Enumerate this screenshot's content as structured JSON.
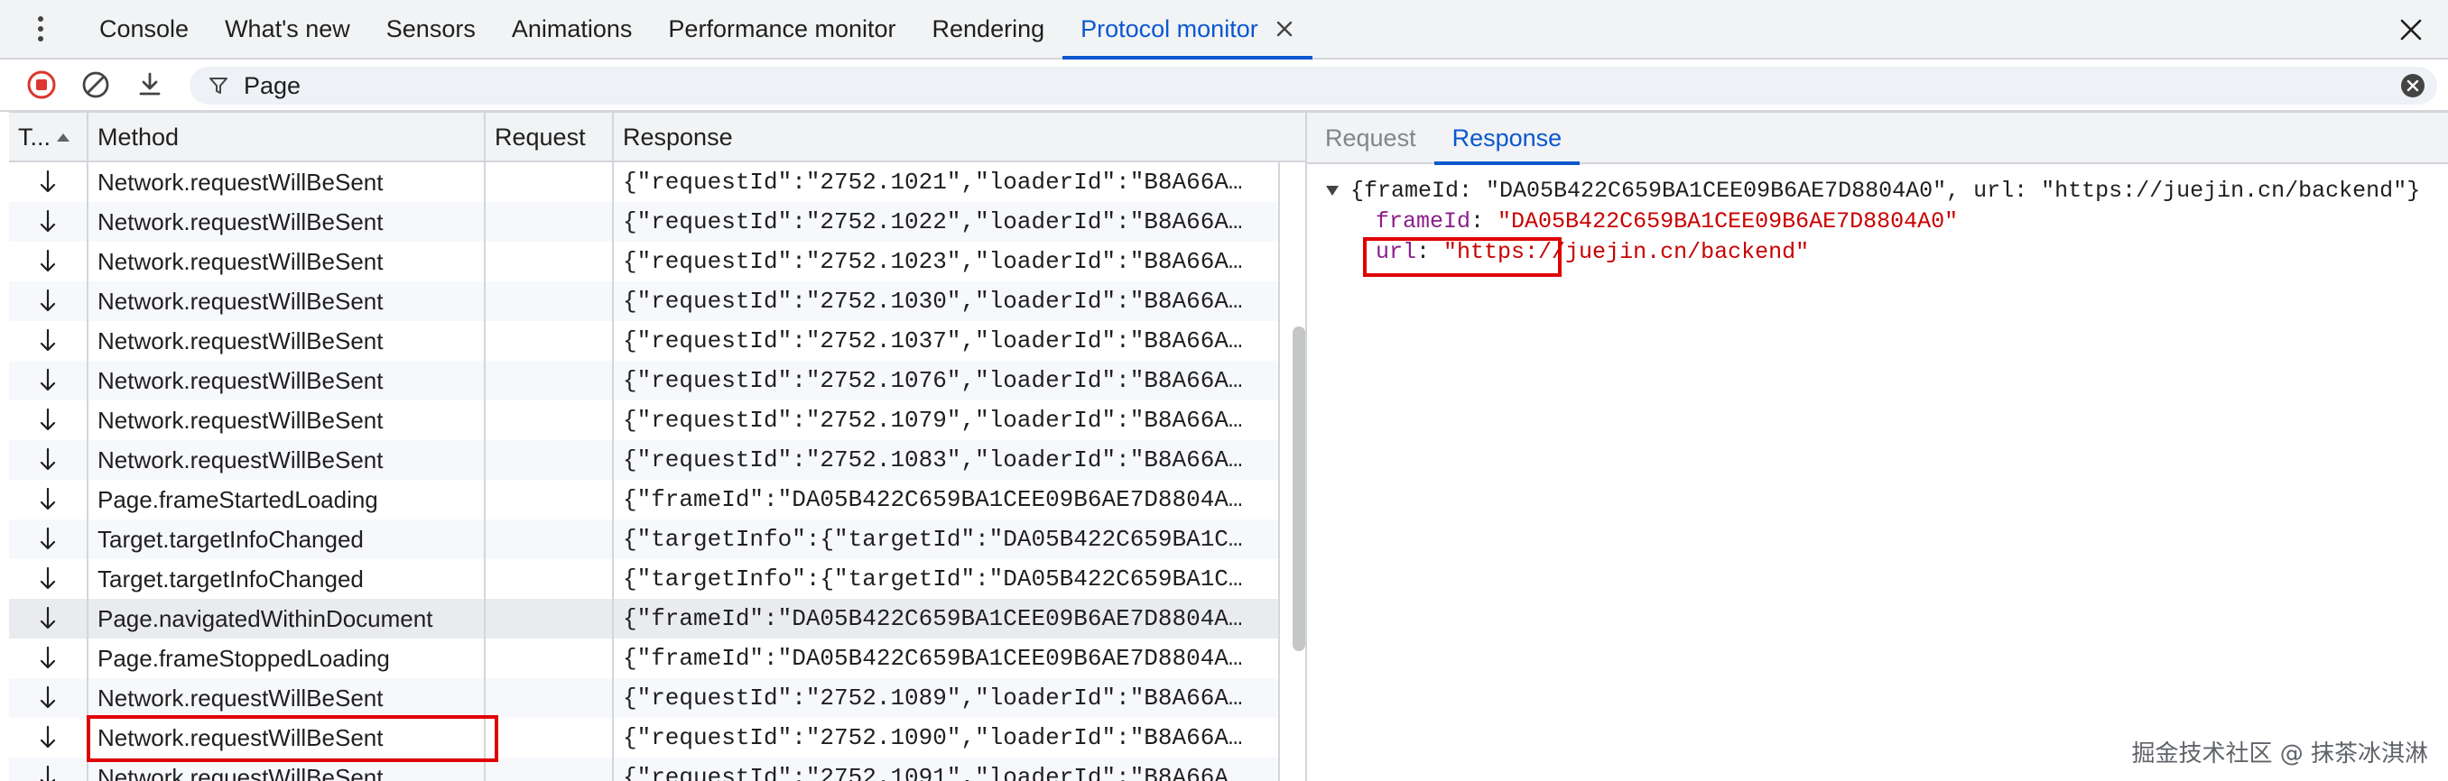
{
  "tabbar": {
    "tabs": [
      {
        "label": "Console",
        "active": false
      },
      {
        "label": "What's new",
        "active": false
      },
      {
        "label": "Sensors",
        "active": false
      },
      {
        "label": "Animations",
        "active": false
      },
      {
        "label": "Performance monitor",
        "active": false
      },
      {
        "label": "Rendering",
        "active": false
      },
      {
        "label": "Protocol monitor",
        "active": true
      }
    ]
  },
  "toolbar": {
    "filter_value": "Page"
  },
  "table": {
    "headers": {
      "type": "T...",
      "method": "Method",
      "request": "Request",
      "response": "Response"
    },
    "rows": [
      {
        "method": "Network.requestWillBeSent",
        "request": "",
        "response": "{\"requestId\":\"2752.1021\",\"loaderId\":\"B8A66A…"
      },
      {
        "method": "Network.requestWillBeSent",
        "request": "",
        "response": "{\"requestId\":\"2752.1022\",\"loaderId\":\"B8A66A…"
      },
      {
        "method": "Network.requestWillBeSent",
        "request": "",
        "response": "{\"requestId\":\"2752.1023\",\"loaderId\":\"B8A66A…"
      },
      {
        "method": "Network.requestWillBeSent",
        "request": "",
        "response": "{\"requestId\":\"2752.1030\",\"loaderId\":\"B8A66A…"
      },
      {
        "method": "Network.requestWillBeSent",
        "request": "",
        "response": "{\"requestId\":\"2752.1037\",\"loaderId\":\"B8A66A…"
      },
      {
        "method": "Network.requestWillBeSent",
        "request": "",
        "response": "{\"requestId\":\"2752.1076\",\"loaderId\":\"B8A66A…"
      },
      {
        "method": "Network.requestWillBeSent",
        "request": "",
        "response": "{\"requestId\":\"2752.1079\",\"loaderId\":\"B8A66A…"
      },
      {
        "method": "Network.requestWillBeSent",
        "request": "",
        "response": "{\"requestId\":\"2752.1083\",\"loaderId\":\"B8A66A…"
      },
      {
        "method": "Page.frameStartedLoading",
        "request": "",
        "response": "{\"frameId\":\"DA05B422C659BA1CEE09B6AE7D8804A…"
      },
      {
        "method": "Target.targetInfoChanged",
        "request": "",
        "response": "{\"targetInfo\":{\"targetId\":\"DA05B422C659BA1C…"
      },
      {
        "method": "Target.targetInfoChanged",
        "request": "",
        "response": "{\"targetInfo\":{\"targetId\":\"DA05B422C659BA1C…"
      },
      {
        "method": "Page.navigatedWithinDocument",
        "request": "",
        "response": "{\"frameId\":\"DA05B422C659BA1CEE09B6AE7D8804A…",
        "selected": true
      },
      {
        "method": "Page.frameStoppedLoading",
        "request": "",
        "response": "{\"frameId\":\"DA05B422C659BA1CEE09B6AE7D8804A…"
      },
      {
        "method": "Network.requestWillBeSent",
        "request": "",
        "response": "{\"requestId\":\"2752.1089\",\"loaderId\":\"B8A66A…"
      },
      {
        "method": "Network.requestWillBeSent",
        "request": "",
        "response": "{\"requestId\":\"2752.1090\",\"loaderId\":\"B8A66A…"
      },
      {
        "method": "Network.requestWillBeSent",
        "request": "",
        "response": "{\"requestId\":\"2752.1091\",\"loaderId\":\"B8A66A…"
      }
    ]
  },
  "detail": {
    "tabs": [
      {
        "label": "Request",
        "active": false
      },
      {
        "label": "Response",
        "active": true
      }
    ],
    "summary": "{frameId: \"DA05B422C659BA1CEE09B6AE7D8804A0\", url: \"https://juejin.cn/backend\"}",
    "fields": [
      {
        "key": "frameId",
        "value": "\"DA05B422C659BA1CEE09B6AE7D8804A0\""
      },
      {
        "key": "url",
        "value": "\"https://juejin.cn/backend\""
      }
    ]
  },
  "watermark": "掘金技术社区 @ 抹茶冰淇淋",
  "colors": {
    "accent": "#0b57d0",
    "record_red": "#dc362e",
    "annotation_red": "#e00000",
    "json_key": "#8b1e8b",
    "json_string": "#c80000"
  },
  "icons": [
    "kebab-menu-icon",
    "close-icon",
    "stop-recording-icon",
    "clear-icon",
    "download-icon",
    "filter-icon",
    "clear-filter-icon",
    "sort-ascending-icon",
    "arrow-down-icon",
    "expand-triangle-icon"
  ]
}
